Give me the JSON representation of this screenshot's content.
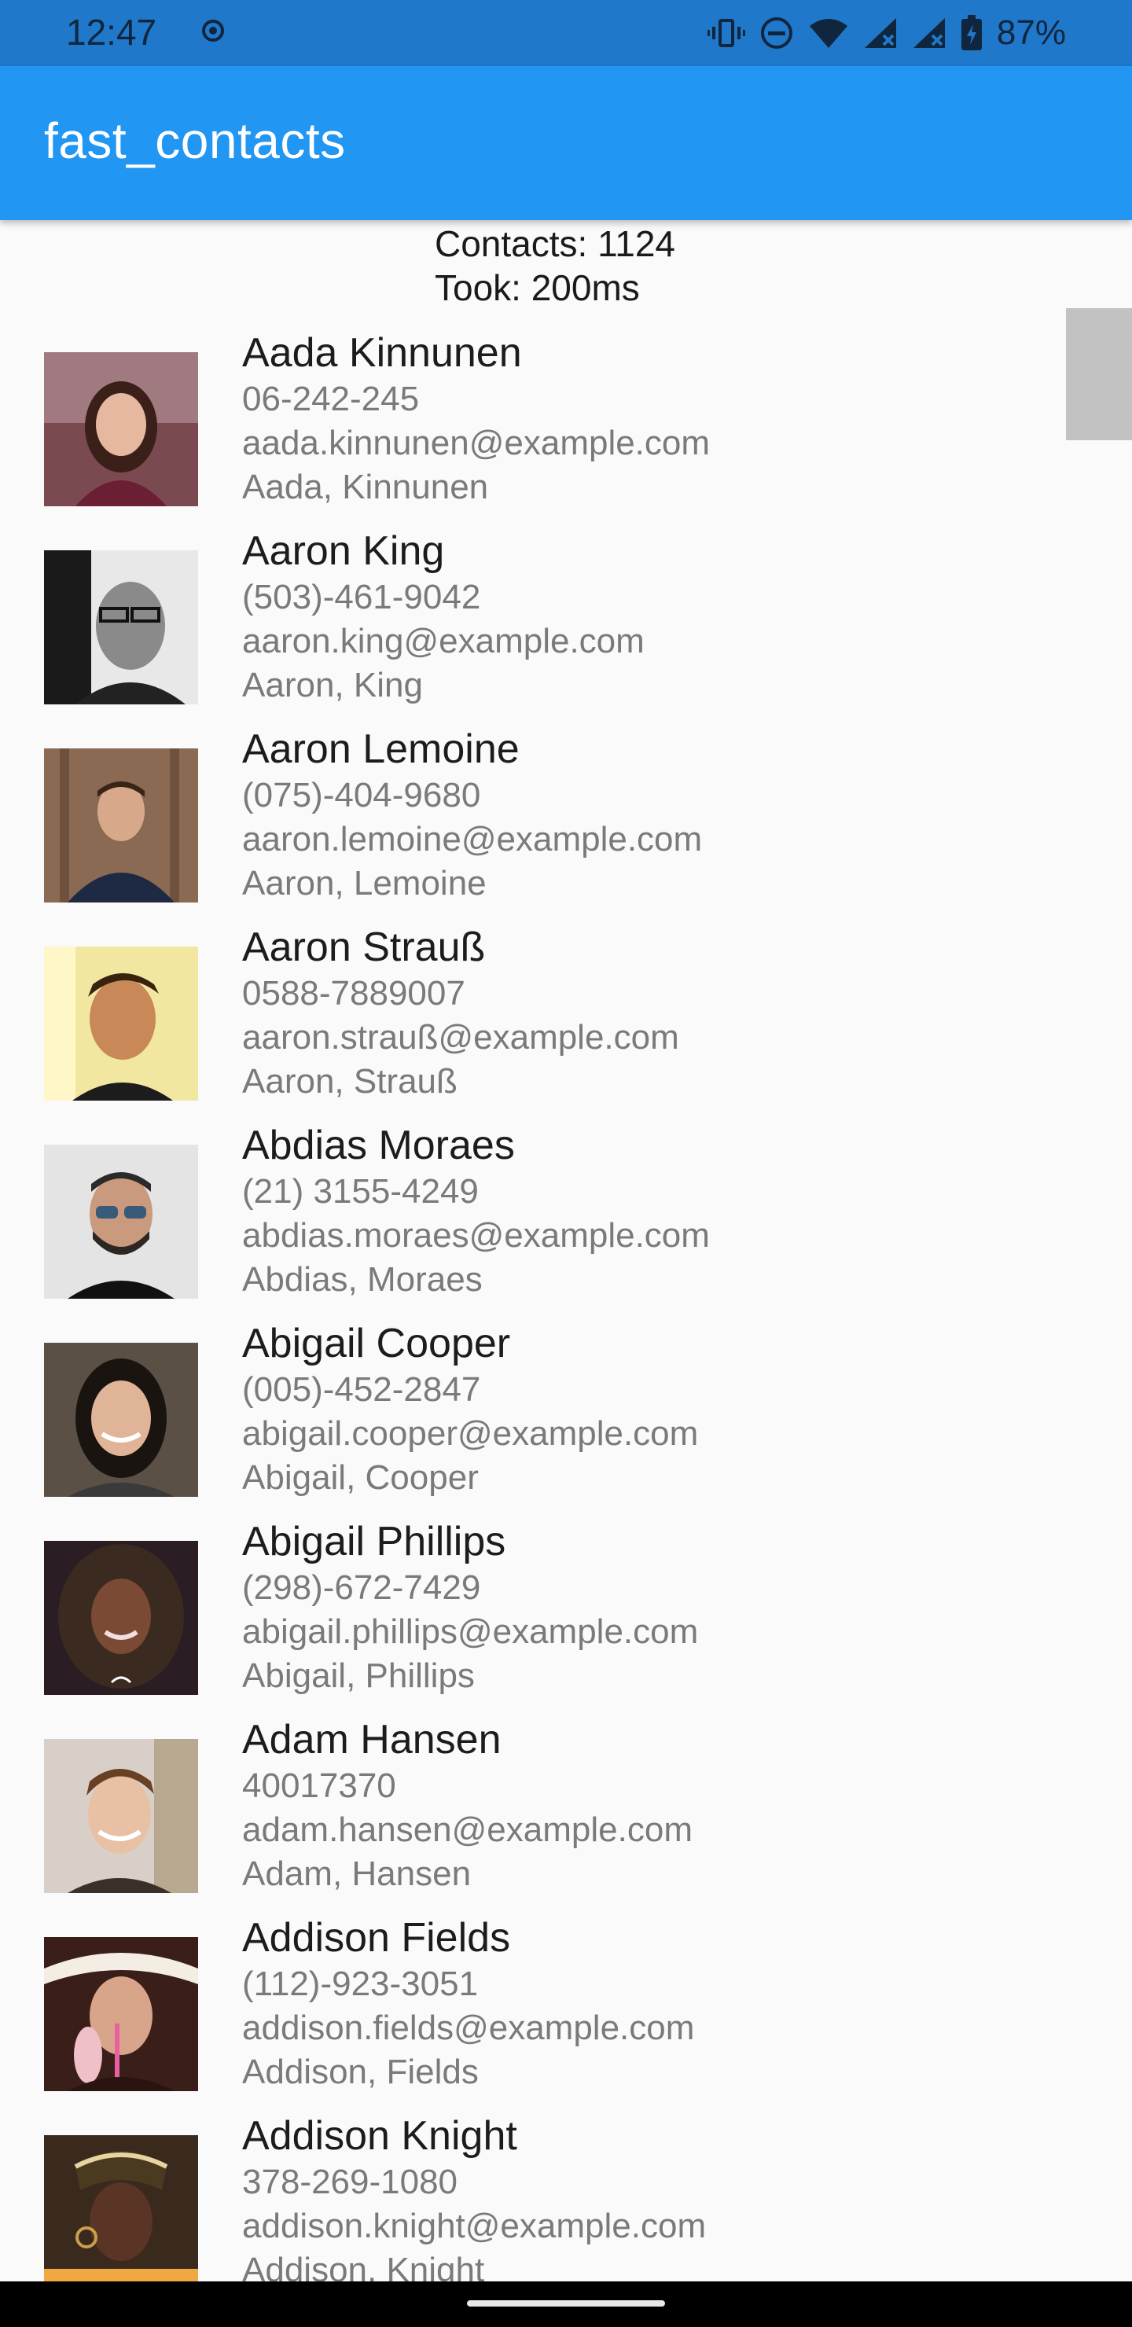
{
  "status_bar": {
    "time": "12:47",
    "battery": "87%",
    "icons": [
      "record-icon",
      "vibrate-icon",
      "do-not-disturb-icon",
      "wifi-icon",
      "signal-icon",
      "signal-icon-2",
      "battery-icon"
    ]
  },
  "app_bar": {
    "title": "fast_contacts"
  },
  "summary": {
    "contacts": "Contacts: 1124",
    "took": "Took: 200ms"
  },
  "contacts": [
    {
      "name": "Aada Kinnunen",
      "phone": "06-242-245",
      "email": "aada.kinnunen@example.com",
      "structured": "Aada, Kinnunen"
    },
    {
      "name": "Aaron King",
      "phone": "(503)-461-9042",
      "email": "aaron.king@example.com",
      "structured": "Aaron, King"
    },
    {
      "name": "Aaron Lemoine",
      "phone": "(075)-404-9680",
      "email": "aaron.lemoine@example.com",
      "structured": "Aaron, Lemoine"
    },
    {
      "name": "Aaron Strauß",
      "phone": "0588-7889007",
      "email": "aaron.strauß@example.com",
      "structured": "Aaron, Strauß"
    },
    {
      "name": "Abdias Moraes",
      "phone": "(21) 3155-4249",
      "email": "abdias.moraes@example.com",
      "structured": "Abdias, Moraes"
    },
    {
      "name": "Abigail Cooper",
      "phone": "(005)-452-2847",
      "email": "abigail.cooper@example.com",
      "structured": "Abigail, Cooper"
    },
    {
      "name": "Abigail Phillips",
      "phone": "(298)-672-7429",
      "email": "abigail.phillips@example.com",
      "structured": "Abigail, Phillips"
    },
    {
      "name": "Adam Hansen",
      "phone": "40017370",
      "email": "adam.hansen@example.com",
      "structured": "Adam, Hansen"
    },
    {
      "name": "Addison Fields",
      "phone": "(112)-923-3051",
      "email": "addison.fields@example.com",
      "structured": "Addison, Fields"
    },
    {
      "name": "Addison Knight",
      "phone": "378-269-1080",
      "email": "addison.knight@example.com",
      "structured": "Addison, Knight"
    }
  ],
  "colors": {
    "status_bar": "#1f78c9",
    "app_bar": "#2196f3",
    "background": "#fafafa",
    "secondary_text": "#7a7a7a"
  }
}
